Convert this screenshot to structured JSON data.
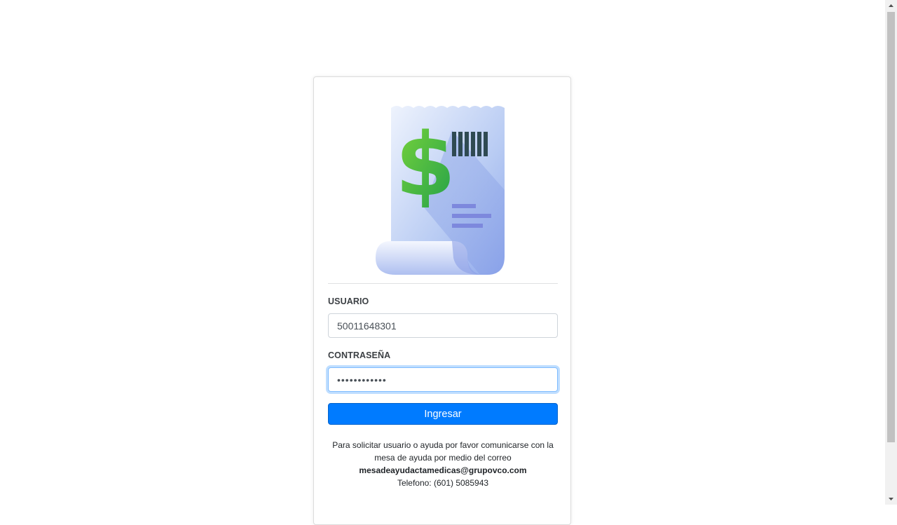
{
  "logo": {
    "icon": "receipt-dollar-icon"
  },
  "form": {
    "user_label": "USUARIO",
    "user_value": "50011648301",
    "password_label": "CONTRASEÑA",
    "password_value": "••••••••••••",
    "submit_label": "Ingresar"
  },
  "help": {
    "line1": "Para solicitar usuario o ayuda por favor comunicarse con la",
    "line2": "mesa de ayuda por medio del correo",
    "email": "mesadeayudactamedicas@grupovco.com",
    "phone": "Telefono: (601) 5085943"
  },
  "colors": {
    "primary": "#007bff",
    "dollar_green": "#4caf3a"
  }
}
